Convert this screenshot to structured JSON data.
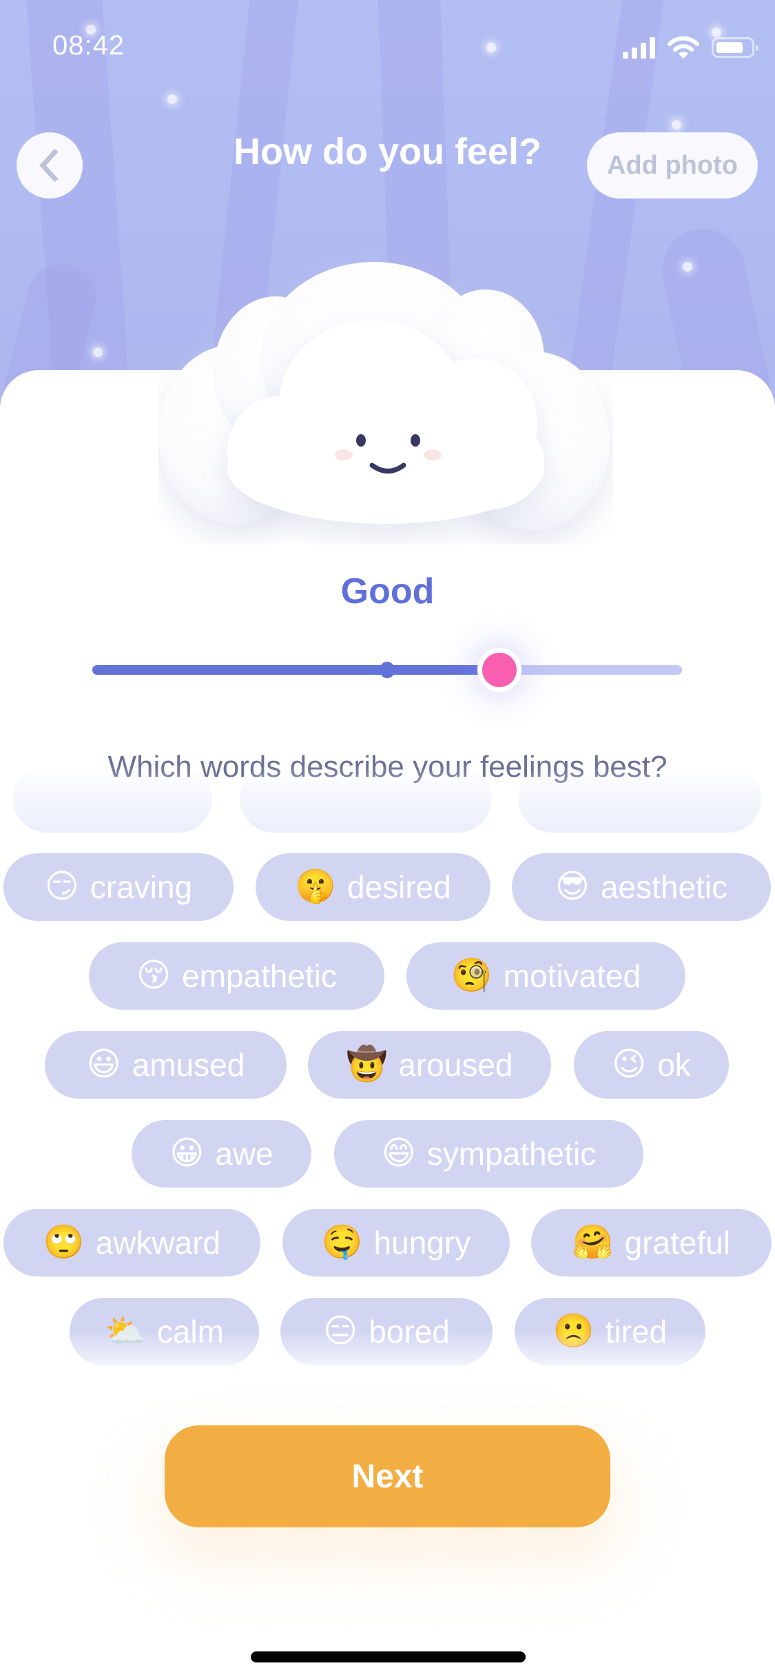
{
  "status_bar": {
    "time": "08:42",
    "icons": [
      "cellular-signal-icon",
      "wifi-icon",
      "battery-icon"
    ]
  },
  "header": {
    "back_icon": "chevron-left-icon",
    "title": "How do you feel?",
    "add_photo_label": "Add photo"
  },
  "mood": {
    "illustration": "smiling-cloud",
    "label": "Good",
    "slider_value_fraction": 0.69,
    "slider_midpoint_fraction": 0.5,
    "colors": {
      "accent": "#6172D9",
      "track_inactive": "#C3C8F7",
      "thumb": "#F85FB0"
    }
  },
  "question": "Which words describe your feelings best?",
  "feelings": [
    {
      "emoji": "",
      "label": "",
      "faded": true
    },
    {
      "emoji": "",
      "label": "",
      "faded": true
    },
    {
      "emoji": "",
      "label": "",
      "faded": true
    },
    {
      "emoji": "😏",
      "label": "craving"
    },
    {
      "emoji": "🤫",
      "label": "desired"
    },
    {
      "emoji": "😎",
      "label": "aesthetic"
    },
    {
      "emoji": "😚",
      "label": "empathetic"
    },
    {
      "emoji": "🧐",
      "label": "motivated"
    },
    {
      "emoji": "😃",
      "label": "amused"
    },
    {
      "emoji": "🤠",
      "label": "aroused"
    },
    {
      "emoji": "😉",
      "label": "ok"
    },
    {
      "emoji": "😀",
      "label": "awe"
    },
    {
      "emoji": "😄",
      "label": "sympathetic"
    },
    {
      "emoji": "🙄",
      "label": "awkward"
    },
    {
      "emoji": "🤤",
      "label": "hungry"
    },
    {
      "emoji": "🤗",
      "label": "grateful"
    },
    {
      "emoji": "⛅",
      "label": "calm"
    },
    {
      "emoji": "😑",
      "label": "bored"
    },
    {
      "emoji": "🙁",
      "label": "tired"
    }
  ],
  "chip_color": "#D2D5F2",
  "next_label": "Next",
  "next_color": "#F2AE42"
}
